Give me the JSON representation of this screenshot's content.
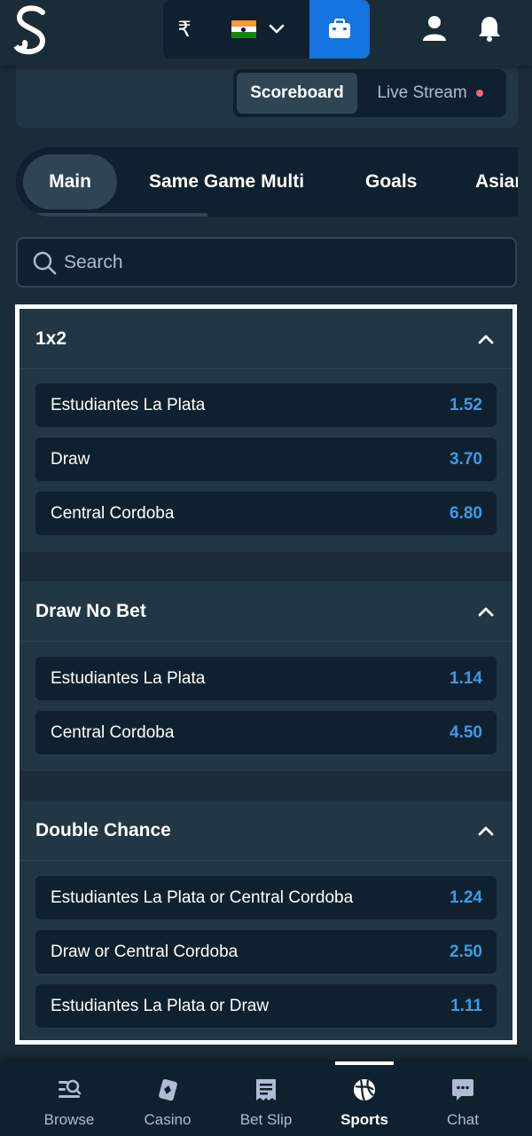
{
  "header": {
    "currency_symbol": "₹",
    "flag_colors": [
      "#ff9933",
      "#ffffff",
      "#138808"
    ],
    "accent_color": "#1475e1",
    "icons": [
      "logo-icon",
      "chevron-down-icon",
      "wallet-icon",
      "user-icon",
      "bell-icon"
    ]
  },
  "media_toggle": {
    "scoreboard_label": "Scoreboard",
    "live_stream_label": "Live Stream"
  },
  "tabs": [
    {
      "label": "Main",
      "active": true
    },
    {
      "label": "Same Game Multi",
      "active": false
    },
    {
      "label": "Goals",
      "active": false
    },
    {
      "label": "Asian",
      "active": false
    }
  ],
  "search": {
    "placeholder": "Search"
  },
  "markets": [
    {
      "title": "1x2",
      "outcomes": [
        {
          "name": "Estudiantes La Plata",
          "odds": "1.52"
        },
        {
          "name": "Draw",
          "odds": "3.70"
        },
        {
          "name": "Central Cordoba",
          "odds": "6.80"
        }
      ]
    },
    {
      "title": "Draw No Bet",
      "outcomes": [
        {
          "name": "Estudiantes La Plata",
          "odds": "1.14"
        },
        {
          "name": "Central Cordoba",
          "odds": "4.50"
        }
      ]
    },
    {
      "title": "Double Chance",
      "outcomes": [
        {
          "name": "Estudiantes La Plata or Central Cordoba",
          "odds": "1.24"
        },
        {
          "name": "Draw or Central Cordoba",
          "odds": "2.50"
        },
        {
          "name": "Estudiantes La Plata or Draw",
          "odds": "1.11"
        }
      ]
    }
  ],
  "bottom_nav": [
    {
      "label": "Browse",
      "icon": "browse-icon",
      "active": false
    },
    {
      "label": "Casino",
      "icon": "casino-icon",
      "active": false
    },
    {
      "label": "Bet Slip",
      "icon": "bet-slip-icon",
      "active": false
    },
    {
      "label": "Sports",
      "icon": "sports-icon",
      "active": true
    },
    {
      "label": "Chat",
      "icon": "chat-icon",
      "active": false
    }
  ]
}
